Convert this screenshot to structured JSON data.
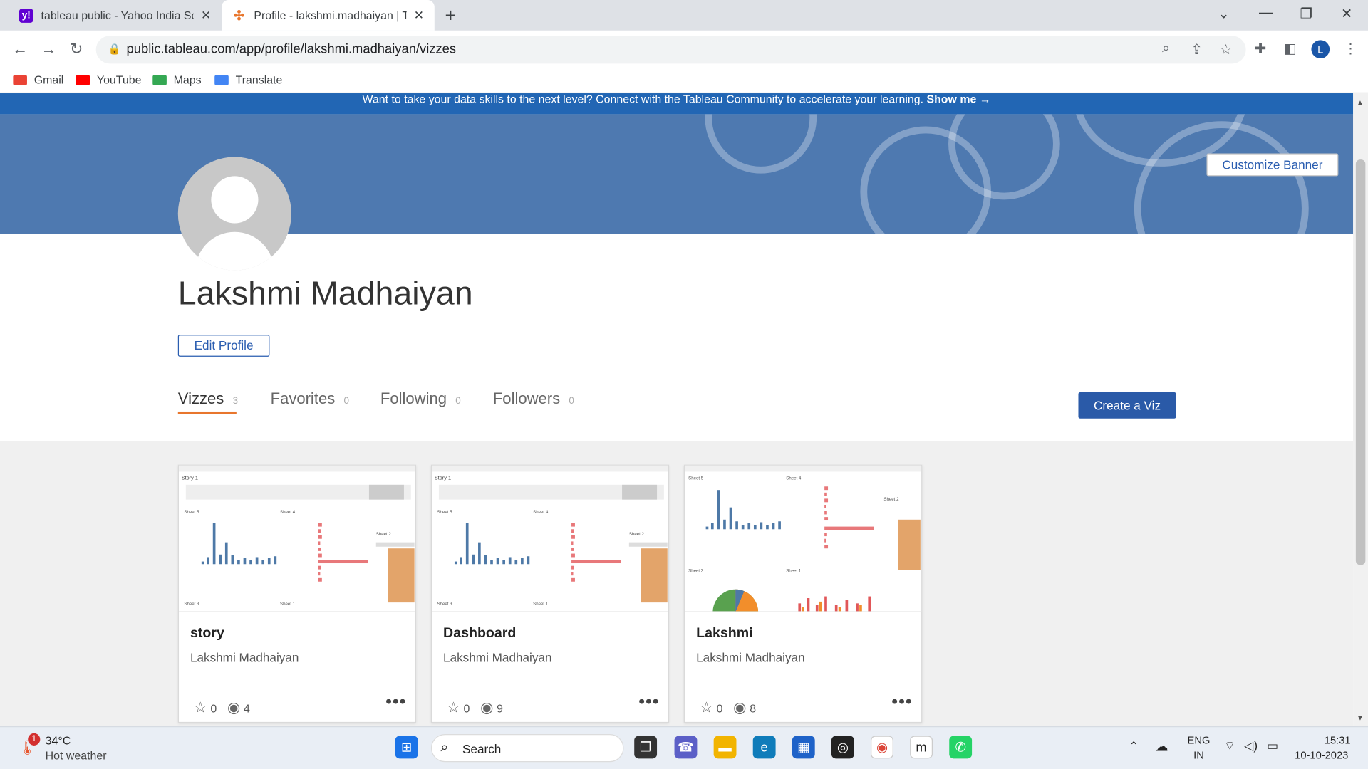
{
  "browser": {
    "tabs": [
      {
        "title": "tableau public - Yahoo India Sea",
        "icon": "yahoo-icon"
      },
      {
        "title": "Profile - lakshmi.madhaiyan | Tal",
        "icon": "tableau-icon"
      }
    ],
    "url": "public.tableau.com/app/profile/lakshmi.madhaiyan/vizzes",
    "profile_initial": "L",
    "bookmarks": [
      {
        "label": "Gmail"
      },
      {
        "label": "YouTube"
      },
      {
        "label": "Maps"
      },
      {
        "label": "Translate"
      }
    ]
  },
  "page": {
    "announcement": "Want to take your data skills to the next level? Connect with the Tableau Community to accelerate your learning.",
    "announcement_link": "Show me →",
    "customize_banner": "Customize Banner",
    "profile_name": "Lakshmi Madhaiyan",
    "edit_profile": "Edit Profile",
    "create_viz": "Create a Viz",
    "tabs": [
      {
        "label": "Vizzes",
        "count": "3"
      },
      {
        "label": "Favorites",
        "count": "0"
      },
      {
        "label": "Following",
        "count": "0"
      },
      {
        "label": "Followers",
        "count": "0"
      }
    ],
    "cards": [
      {
        "title": "story",
        "author": "Lakshmi Madhaiyan",
        "favorites": "0",
        "views": "4",
        "thumb_label": "Story 1",
        "sheet_labels": [
          "Sheet 5",
          "Sheet 4",
          "Sheet 3",
          "Sheet 1",
          "Sheet 2"
        ]
      },
      {
        "title": "Dashboard",
        "author": "Lakshmi Madhaiyan",
        "favorites": "0",
        "views": "9",
        "thumb_label": "Story 1",
        "sheet_labels": [
          "Sheet 5",
          "Sheet 4",
          "Sheet 3",
          "Sheet 1",
          "Sheet 2"
        ]
      },
      {
        "title": "Lakshmi",
        "author": "Lakshmi Madhaiyan",
        "favorites": "0",
        "views": "8",
        "thumb_label": "Sheet 5",
        "sheet_labels": [
          "Sheet 5",
          "Sheet 4",
          "Sheet 3",
          "Sheet 1",
          "Sheet 2"
        ]
      }
    ]
  },
  "taskbar": {
    "weather_temp": "34°C",
    "weather_desc": "Hot weather",
    "weather_badge": "1",
    "search_placeholder": "Search",
    "lang_top": "ENG",
    "lang_bottom": "IN",
    "time": "15:31",
    "date": "10-10-2023"
  },
  "colors": {
    "banner": "#4e79b0",
    "topbar": "#2266b4",
    "accent_orange": "#e8762d",
    "button_blue": "#2a5aa8"
  }
}
